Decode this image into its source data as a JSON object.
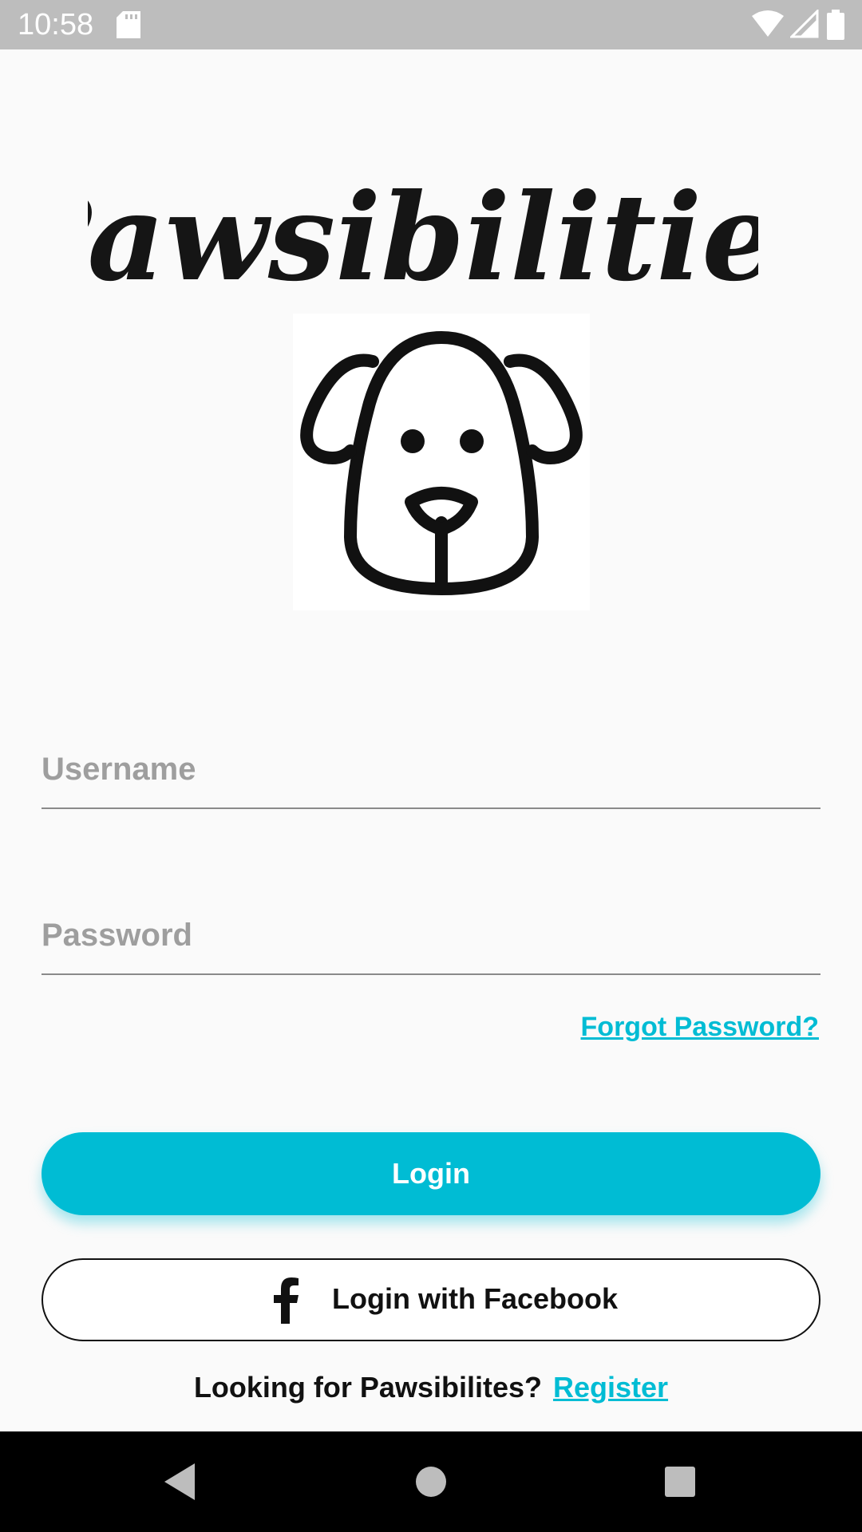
{
  "status_bar": {
    "time": "10:58",
    "icons": [
      "sd-card-icon",
      "wifi-icon",
      "signal-icon",
      "battery-icon"
    ]
  },
  "app": {
    "title": "Pawsibilities",
    "logo_icon": "dog-face-icon"
  },
  "form": {
    "username_placeholder": "Username",
    "username_value": "",
    "password_placeholder": "Password",
    "password_value": "",
    "forgot_label": "Forgot Password?"
  },
  "buttons": {
    "login_label": "Login",
    "facebook_label": "Login with Facebook",
    "facebook_icon": "facebook-icon"
  },
  "register": {
    "prompt": "Looking for Pawsibilites?",
    "link_label": "Register"
  },
  "nav": {
    "icons": [
      "back-icon",
      "home-icon",
      "recents-icon"
    ]
  },
  "colors": {
    "accent": "#00bcd4",
    "background": "#fafafa",
    "status_bar": "#bdbdbd",
    "nav_bar": "#000000"
  }
}
